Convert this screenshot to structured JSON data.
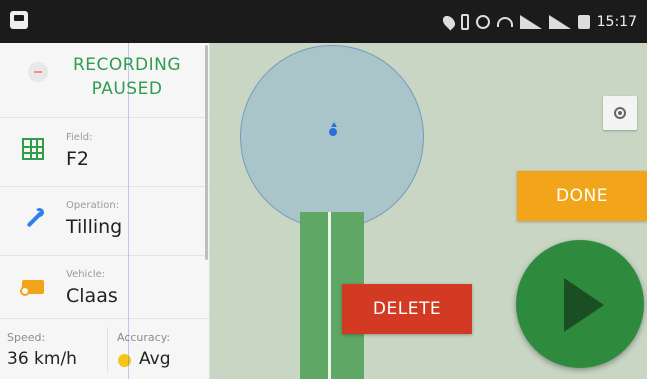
{
  "status_bar": {
    "time": "15:17",
    "icons": [
      "location-icon",
      "battery-saver-icon",
      "sync-icon",
      "wifi-icon",
      "signal-icon",
      "signal-icon",
      "sd-card-icon"
    ]
  },
  "panel": {
    "recording_status": "RECORDING PAUSED",
    "field": {
      "label": "Field:",
      "value": "F2"
    },
    "operation": {
      "label": "Operation:",
      "value": "Tilling"
    },
    "vehicle": {
      "label": "Vehicle:",
      "value": "Claas"
    },
    "speed": {
      "label": "Speed:",
      "value": "36 km/h"
    },
    "accuracy": {
      "label": "Accuracy:",
      "value": "Avg",
      "color": "#f5c518"
    }
  },
  "map": {
    "done_label": "DONE",
    "delete_label": "DELETE",
    "colors": {
      "track": "#5ea764",
      "done": "#f2a51b",
      "delete": "#d23a23",
      "play": "#2e8b3e",
      "recording_text": "#2e9e4d"
    }
  }
}
